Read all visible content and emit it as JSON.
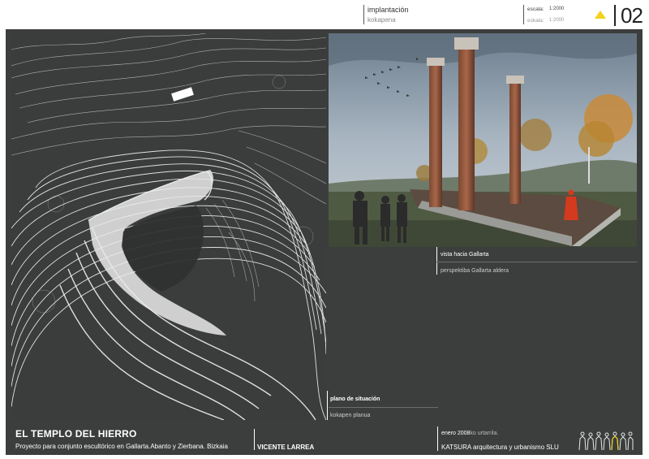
{
  "header": {
    "title": "implantación",
    "subtitle": "kokapena",
    "scale_label_es": "escala:",
    "scale_value_es": "1:2000",
    "scale_label_eu": "eskala:",
    "scale_value_eu": "1:2000",
    "page_number": "02",
    "triangle_color": "#f2d21c"
  },
  "map": {
    "label": "plano de situación",
    "label_basque": "kokapen planua"
  },
  "photo": {
    "label": "vista hacia Gallarta",
    "label_basque": "perspektiba Gallarta aldera"
  },
  "footer": {
    "title": "EL TEMPLO DEL HIERRO",
    "subtitle": "Proyecto para conjunto escultórico en Gallarta.Abanto y Zierbana. Bizkaia",
    "author": "VICENTE LARREA",
    "date": "enero 2008",
    "date_basque": "ko urtarrila.",
    "company": "KATSURA arquitectura y urbanismo SLU"
  },
  "colors": {
    "panel": "#3b3e3c",
    "accent": "#f2d21c"
  }
}
